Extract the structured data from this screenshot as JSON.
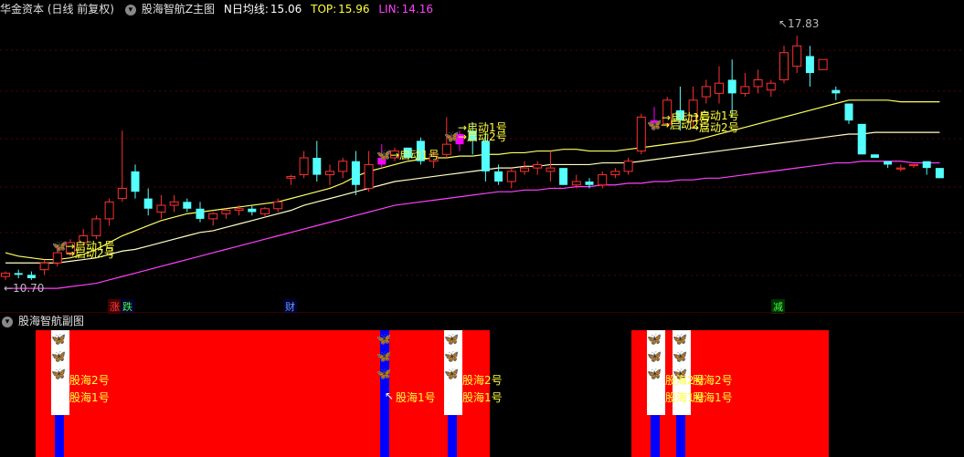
{
  "main_header": {
    "title": "华金资本 (日线 前复权)",
    "indicator": "股海智航Z主图",
    "ma_label": "N日均线:",
    "ma_value": "15.06",
    "top_label": "TOP:",
    "top_value": "15.96",
    "lin_label": "LIN:",
    "lin_value": "14.16"
  },
  "sub_header": {
    "title": "股海智航副图"
  },
  "price_marks": {
    "high": "17.83",
    "low": "10.70"
  },
  "bottom_tags": [
    "涨",
    "跌",
    "财",
    "减"
  ],
  "signal_labels": {
    "start1": "→启动1号",
    "start2": "→启动2号"
  },
  "sub_labels": {
    "gh2": "股海2号",
    "gh1": "股海1号"
  },
  "colors": {
    "up": "#ff3030",
    "down": "#54ffff",
    "ma": "#ffff60",
    "top": "#ffffc0",
    "lin": "#ff40ff",
    "sub_red": "#ff0000",
    "sub_blue": "#0000ff",
    "magenta_candle": "#ff00ff"
  },
  "chart_data": {
    "type": "candlestick",
    "y_range": [
      10.4,
      18.2
    ],
    "candles": [
      [
        10.8,
        10.95,
        10.7,
        10.9
      ],
      [
        10.9,
        11.0,
        10.75,
        10.85
      ],
      [
        10.85,
        10.95,
        10.7,
        10.75
      ],
      [
        11.0,
        11.3,
        10.85,
        11.2
      ],
      [
        11.2,
        11.6,
        11.1,
        11.5
      ],
      [
        11.5,
        11.9,
        11.4,
        11.8
      ],
      [
        11.8,
        12.2,
        11.7,
        12.0
      ],
      [
        12.0,
        12.6,
        11.9,
        12.5
      ],
      [
        12.5,
        13.1,
        12.3,
        13.0
      ],
      [
        13.1,
        15.1,
        13.0,
        13.4
      ],
      [
        13.9,
        14.1,
        13.1,
        13.3
      ],
      [
        13.1,
        13.4,
        12.6,
        12.8
      ],
      [
        12.7,
        13.2,
        12.5,
        12.9
      ],
      [
        12.9,
        13.2,
        12.7,
        13.0
      ],
      [
        13.0,
        13.1,
        12.7,
        12.8
      ],
      [
        12.8,
        13.0,
        12.4,
        12.5
      ],
      [
        12.5,
        12.7,
        12.3,
        12.65
      ],
      [
        12.65,
        12.8,
        12.5,
        12.75
      ],
      [
        12.75,
        12.9,
        12.6,
        12.8
      ],
      [
        12.8,
        12.9,
        12.6,
        12.7
      ],
      [
        12.65,
        12.85,
        12.55,
        12.8
      ],
      [
        12.8,
        13.1,
        12.7,
        13.0
      ],
      [
        13.7,
        13.8,
        13.5,
        13.75
      ],
      [
        13.8,
        14.5,
        13.7,
        14.3
      ],
      [
        14.3,
        14.8,
        13.6,
        13.8
      ],
      [
        13.8,
        14.1,
        13.5,
        13.9
      ],
      [
        13.9,
        14.3,
        13.7,
        14.2
      ],
      [
        14.2,
        14.5,
        13.2,
        13.5
      ],
      [
        13.4,
        14.5,
        13.3,
        14.1
      ],
      [
        14.1,
        14.7,
        14.0,
        14.3
      ],
      [
        14.3,
        14.6,
        14.2,
        14.5
      ],
      [
        14.6,
        14.3,
        14.6,
        14.3
      ],
      [
        14.8,
        14.9,
        14.1,
        14.2
      ],
      [
        14.2,
        14.5,
        14.0,
        14.35
      ],
      [
        14.4,
        15.5,
        14.3,
        14.7
      ],
      [
        14.7,
        15.1,
        14.5,
        15.0
      ],
      [
        15.1,
        15.3,
        14.4,
        14.8
      ],
      [
        14.8,
        15.0,
        13.6,
        13.9
      ],
      [
        13.9,
        14.1,
        13.5,
        13.6
      ],
      [
        13.6,
        14.0,
        13.4,
        13.9
      ],
      [
        13.9,
        14.2,
        13.8,
        14.0
      ],
      [
        14.0,
        14.2,
        13.8,
        14.1
      ],
      [
        13.9,
        14.5,
        13.6,
        14.0
      ],
      [
        14.0,
        14.0,
        13.5,
        13.5
      ],
      [
        13.5,
        13.8,
        13.4,
        13.6
      ],
      [
        13.6,
        13.7,
        13.4,
        13.5
      ],
      [
        13.5,
        13.9,
        13.4,
        13.8
      ],
      [
        13.8,
        14.0,
        13.7,
        13.9
      ],
      [
        13.9,
        14.3,
        13.8,
        14.2
      ],
      [
        14.5,
        15.6,
        14.4,
        15.5
      ],
      [
        15.4,
        15.8,
        15.1,
        15.3
      ],
      [
        15.3,
        16.1,
        15.2,
        16.0
      ],
      [
        15.7,
        16.4,
        15.1,
        15.4
      ],
      [
        15.4,
        16.4,
        15.2,
        16.0
      ],
      [
        16.1,
        16.6,
        15.9,
        16.4
      ],
      [
        16.2,
        17.0,
        15.9,
        16.5
      ],
      [
        16.6,
        17.2,
        15.5,
        16.2
      ],
      [
        16.2,
        16.8,
        16.1,
        16.4
      ],
      [
        16.4,
        16.9,
        16.2,
        16.6
      ],
      [
        16.3,
        16.6,
        16.1,
        16.5
      ],
      [
        16.6,
        17.6,
        16.5,
        17.4
      ],
      [
        17.0,
        17.9,
        16.8,
        17.6
      ],
      [
        17.3,
        17.6,
        16.4,
        16.8
      ],
      [
        16.9,
        17.2,
        16.9,
        17.2
      ],
      [
        16.3,
        16.4,
        16.0,
        16.2
      ],
      [
        15.9,
        15.9,
        15.3,
        15.4
      ],
      [
        15.3,
        15.3,
        14.4,
        14.4
      ],
      [
        14.4,
        14.3,
        14.4,
        14.3
      ],
      [
        14.2,
        14.2,
        14.0,
        14.1
      ],
      [
        14.0,
        14.1,
        13.9,
        14.0
      ],
      [
        14.1,
        14.1,
        14.0,
        14.1
      ],
      [
        14.2,
        14.1,
        13.8,
        14.0
      ],
      [
        14.0,
        14.0,
        13.7,
        13.7
      ]
    ],
    "ma_series": [
      11.5,
      11.4,
      11.35,
      11.3,
      11.3,
      11.35,
      11.45,
      11.6,
      11.8,
      12.0,
      12.15,
      12.3,
      12.45,
      12.55,
      12.65,
      12.7,
      12.75,
      12.8,
      12.85,
      12.9,
      12.95,
      13.0,
      13.1,
      13.2,
      13.3,
      13.4,
      13.55,
      13.75,
      13.9,
      14.0,
      14.1,
      14.2,
      14.25,
      14.3,
      14.3,
      14.35,
      14.35,
      14.4,
      14.4,
      14.45,
      14.45,
      14.5,
      14.5,
      14.55,
      14.55,
      14.5,
      14.5,
      14.5,
      14.55,
      14.6,
      14.65,
      14.7,
      14.75,
      14.8,
      14.9,
      15.0,
      15.1,
      15.2,
      15.3,
      15.4,
      15.5,
      15.6,
      15.7,
      15.8,
      15.9,
      16.0,
      16.0,
      16.0,
      16.0,
      15.95,
      15.95,
      15.95,
      15.95
    ],
    "top_series": [
      11.2,
      11.2,
      11.2,
      11.2,
      11.2,
      11.25,
      11.3,
      11.35,
      11.45,
      11.55,
      11.6,
      11.7,
      11.8,
      11.9,
      12.0,
      12.1,
      12.15,
      12.25,
      12.35,
      12.45,
      12.55,
      12.65,
      12.75,
      12.9,
      13.0,
      13.1,
      13.2,
      13.3,
      13.4,
      13.5,
      13.6,
      13.65,
      13.7,
      13.75,
      13.8,
      13.85,
      13.9,
      13.95,
      14.0,
      14.0,
      14.05,
      14.05,
      14.1,
      14.1,
      14.1,
      14.1,
      14.15,
      14.15,
      14.15,
      14.2,
      14.25,
      14.3,
      14.35,
      14.4,
      14.45,
      14.5,
      14.55,
      14.6,
      14.65,
      14.7,
      14.75,
      14.8,
      14.85,
      14.9,
      14.95,
      15.0,
      15.0,
      15.05,
      15.05,
      15.05,
      15.05,
      15.05,
      15.05
    ],
    "lin_series": [
      10.45,
      10.45,
      10.45,
      10.45,
      10.45,
      10.5,
      10.55,
      10.6,
      10.7,
      10.8,
      10.9,
      11.0,
      11.1,
      11.2,
      11.3,
      11.4,
      11.5,
      11.6,
      11.7,
      11.8,
      11.9,
      12.0,
      12.1,
      12.2,
      12.3,
      12.4,
      12.5,
      12.6,
      12.7,
      12.8,
      12.9,
      12.95,
      13.0,
      13.05,
      13.1,
      13.15,
      13.2,
      13.25,
      13.3,
      13.3,
      13.35,
      13.35,
      13.4,
      13.4,
      13.45,
      13.45,
      13.5,
      13.5,
      13.55,
      13.55,
      13.6,
      13.6,
      13.65,
      13.65,
      13.7,
      13.7,
      13.75,
      13.8,
      13.85,
      13.9,
      13.95,
      14.0,
      14.05,
      14.1,
      14.15,
      14.15,
      14.2,
      14.2,
      14.2,
      14.2,
      14.15,
      14.15,
      14.15
    ]
  }
}
